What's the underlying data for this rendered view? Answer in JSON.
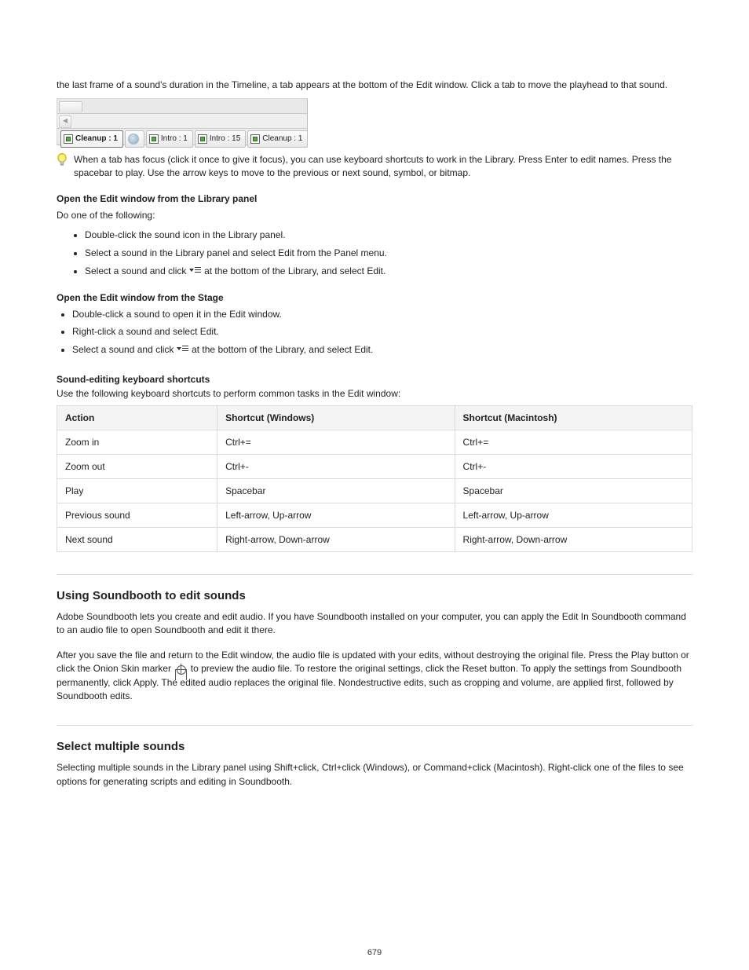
{
  "intro": "the last frame of a sound's duration in the Timeline, a tab appears at the bottom of the Edit window. Click a tab to move the playhead to that sound.",
  "screenshot": {
    "tabs": [
      {
        "label": "Cleanup : 1",
        "icon": "square",
        "active": true
      },
      {
        "label": "",
        "icon": "globe",
        "active": false
      },
      {
        "label": "Intro : 1",
        "icon": "square",
        "active": false
      },
      {
        "label": "Intro : 15",
        "icon": "square",
        "active": false
      },
      {
        "label": "Cleanup : 1",
        "icon": "square",
        "active": false
      }
    ]
  },
  "tip": "When a tab has focus (click it once to give it focus), you can use keyboard shortcuts to work in the Library. Press Enter to edit names. Press the spacebar to play. Use the arrow keys to move to the previous or next sound, symbol, or bitmap.",
  "open_heading": "Open the Edit window from the Library panel",
  "open_instruction": "Do one of the following:",
  "open_list": [
    "Double-click the sound icon in the Library panel.",
    "Select a sound in the Library panel and select Edit from the Panel menu.",
    {
      "prefix": "Select a sound and click ",
      "suffix": " at the bottom of the Library, and select Edit."
    }
  ],
  "open_from_stage_heading": "Open the Edit window from the Stage",
  "open_from_stage_list": [
    "Double-click a sound to open it in the Edit window.",
    "Right-click a sound and select Edit.",
    {
      "prefix": "Select a sound and click ",
      "suffix": " at the bottom of the Library, and select Edit."
    }
  ],
  "shortcuts_heading": "Sound-editing keyboard shortcuts",
  "shortcuts_sub": "Use the following keyboard shortcuts to perform common tasks in the Edit window:",
  "shortcuts_headers": [
    "Action",
    "Shortcut (Windows)",
    "Shortcut (Macintosh)"
  ],
  "shortcuts_rows": [
    [
      "Zoom in",
      "Ctrl+=",
      "Ctrl+="
    ],
    [
      "Zoom out",
      "Ctrl+-",
      "Ctrl+-"
    ],
    [
      "Play",
      "Spacebar",
      "Spacebar"
    ],
    [
      "Previous sound",
      "Left-arrow, Up-arrow",
      "Left-arrow, Up-arrow"
    ],
    [
      "Next sound",
      "Right-arrow, Down-arrow",
      "Right-arrow, Down-arrow"
    ]
  ],
  "context_title": "Using Soundbooth to edit sounds",
  "context_para1": "Adobe Soundbooth lets you create and edit audio. If you have Soundbooth installed on your computer, you can apply the Edit In Soundbooth command to an audio file to open Soundbooth and edit it there.",
  "context_para2_prefix": "After you save the file and return to the Edit window, the audio file is updated with your edits, without destroying the original file. Press the Play button or click the Onion Skin marker ",
  "context_para2_suffix": " to preview the audio file. To restore the original settings, click the Reset button. To apply the settings from Soundbooth permanently, click Apply. The edited audio replaces the original file. Nondestructive edits, such as cropping and volume, are applied first, followed by Soundbooth edits.",
  "select_title": "Select multiple sounds",
  "select_para": "Selecting multiple sounds in the Library panel using Shift+click, Ctrl+click (Windows), or Command+click (Macintosh). Right-click one of the files to see options for generating scripts and editing in Soundbooth.",
  "page_number": "679"
}
